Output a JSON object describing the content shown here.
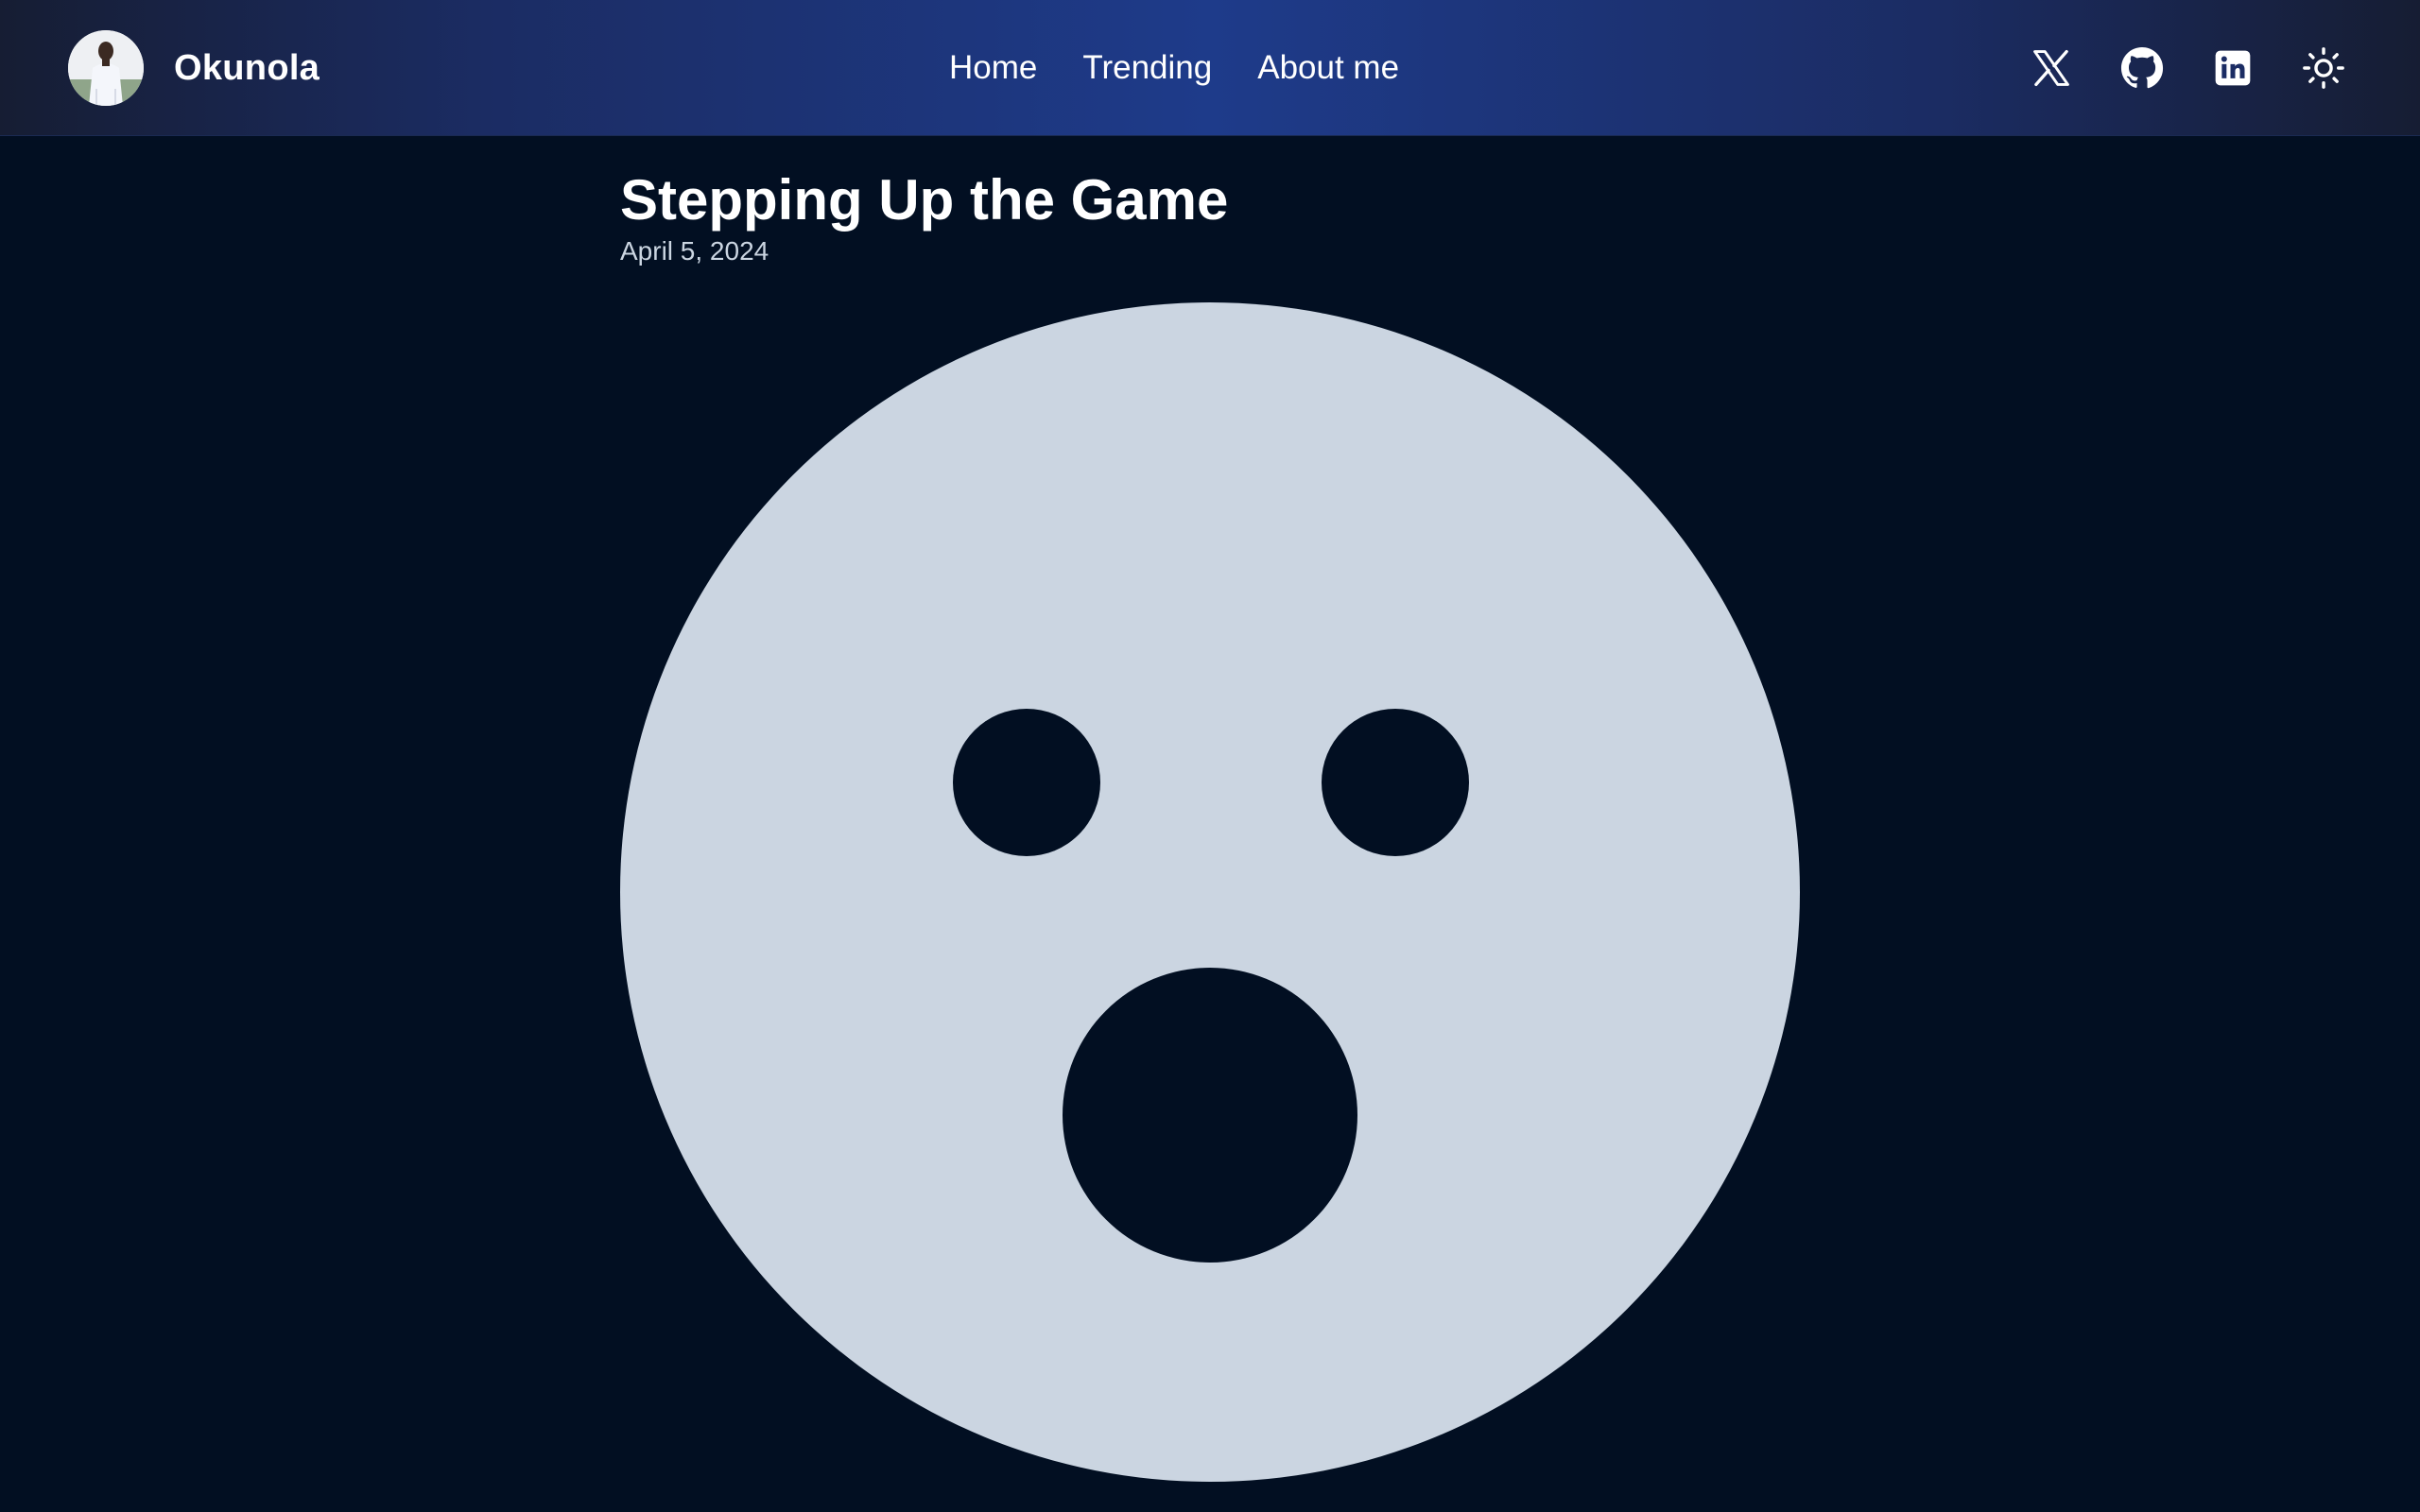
{
  "header": {
    "site_name": "Okunola",
    "avatar_alt": "Okunola profile photo",
    "nav": [
      {
        "label": "Home"
      },
      {
        "label": "Trending"
      },
      {
        "label": "About me"
      }
    ],
    "social": [
      {
        "icon": "x-twitter-icon"
      },
      {
        "icon": "github-icon"
      },
      {
        "icon": "linkedin-icon"
      },
      {
        "icon": "sun-theme-toggle-icon"
      }
    ]
  },
  "post": {
    "title": "Stepping Up the Game",
    "date": "April 5, 2024",
    "hero_icon": "surprised-face-icon"
  },
  "colors": {
    "background": "#020f22",
    "header_accent": "#1e3b8a",
    "face": "#cbd5e1",
    "face_features": "#020f22",
    "date_text": "#cbd5e1"
  }
}
